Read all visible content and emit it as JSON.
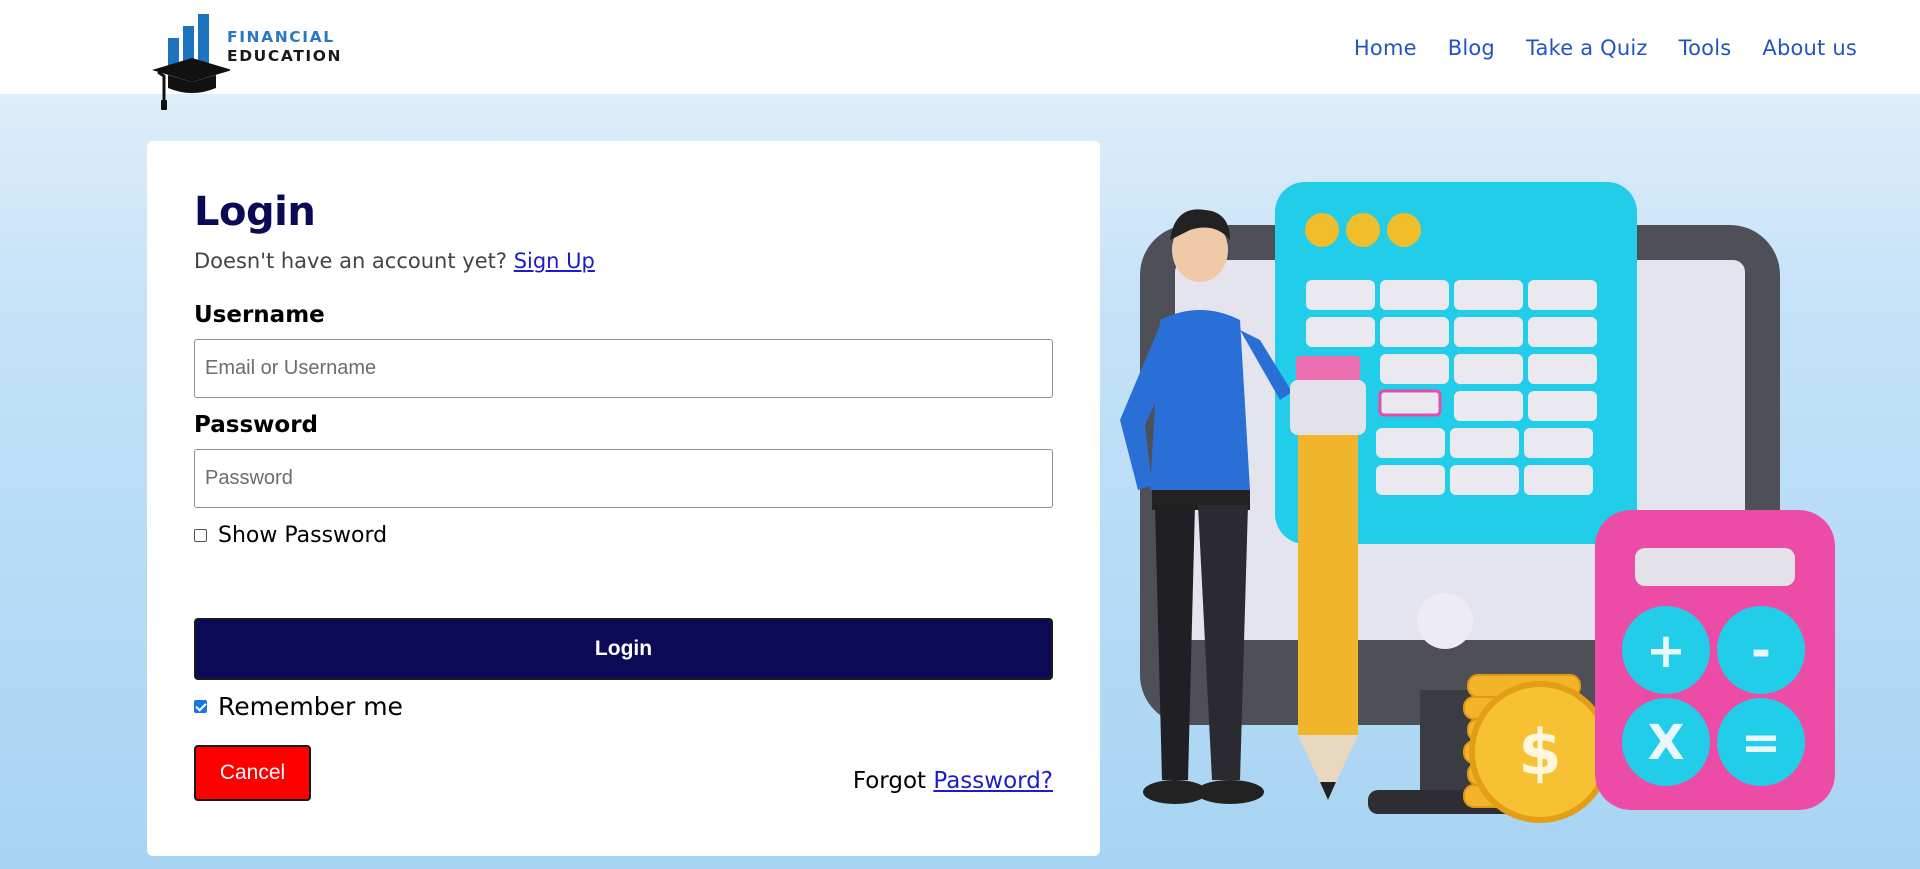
{
  "brand": {
    "line1": "FINANCIAL",
    "line2": "EDUCATION",
    "icon": "graduation-cap-bar-chart-logo"
  },
  "nav": {
    "items": [
      {
        "label": "Home"
      },
      {
        "label": "Blog"
      },
      {
        "label": "Take a Quiz"
      },
      {
        "label": "Tools"
      },
      {
        "label": "About us"
      }
    ]
  },
  "login": {
    "title": "Login",
    "signup_prompt": "Doesn't have an account yet?",
    "signup_link": "Sign Up",
    "username_label": "Username",
    "username_placeholder": "Email or Username",
    "username_value": "",
    "password_label": "Password",
    "password_placeholder": "Password",
    "password_value": "",
    "show_password_label": "Show Password",
    "show_password_checked": false,
    "login_button": "Login",
    "remember_label": "Remember me",
    "remember_checked": true,
    "cancel_button": "Cancel",
    "forgot_prefix": "Forgot",
    "forgot_link": "Password?"
  },
  "illustration": {
    "calculator_keys": [
      "+",
      "-",
      "X",
      "="
    ],
    "coin_symbol": "$"
  },
  "colors": {
    "brand_navy": "#0b0a57",
    "nav_link": "#1f56c2",
    "cancel_red": "#ff0000",
    "link_blue": "#1c1cc8",
    "logo_blue": "#2a78c2"
  }
}
